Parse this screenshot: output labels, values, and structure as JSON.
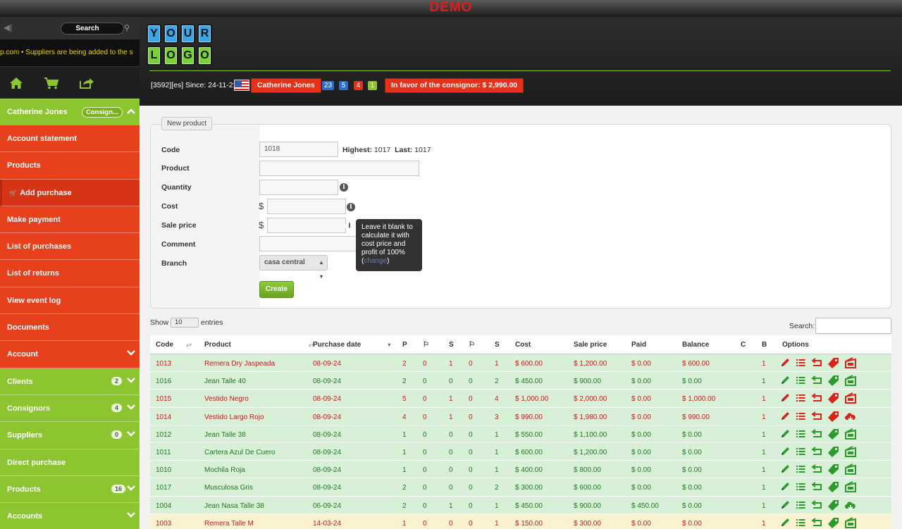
{
  "demo_banner": "DEMO",
  "sidebar": {
    "search_label": "Search",
    "ticker": "p.com  •  Suppliers are being added to the s",
    "user": {
      "name": "Catherine Jones",
      "role_pill": "Consign..."
    },
    "items": [
      {
        "label": "Account statement",
        "color": "red"
      },
      {
        "label": "Products",
        "color": "red"
      },
      {
        "label": "Add purchase",
        "color": "red",
        "active": true
      },
      {
        "label": "Make payment",
        "color": "red"
      },
      {
        "label": "List of purchases",
        "color": "red"
      },
      {
        "label": "List of returns",
        "color": "red"
      },
      {
        "label": "View event log",
        "color": "red"
      },
      {
        "label": "Documents",
        "color": "red"
      },
      {
        "label": "Account",
        "color": "red",
        "chevron": true
      },
      {
        "label": "Clients",
        "color": "green",
        "badge": "2",
        "chevron": true
      },
      {
        "label": "Consignors",
        "color": "green",
        "badge": "4",
        "chevron": true
      },
      {
        "label": "Suppliers",
        "color": "green",
        "badge": "0",
        "chevron": true
      },
      {
        "label": "Direct purchase",
        "color": "green"
      },
      {
        "label": "Products",
        "color": "green",
        "badge": "16",
        "chevron": true
      },
      {
        "label": "Accounts",
        "color": "green",
        "chevron": true
      }
    ]
  },
  "header": {
    "logo_letters": [
      "Y",
      "O",
      "U",
      "R",
      "L",
      "O",
      "G",
      "O"
    ],
    "info": "[3592][es] Since: 24-11-21",
    "user_button": "Catherine Jones",
    "counts": [
      "23",
      "5",
      "4",
      "1"
    ],
    "count_colors": [
      "#2b6fc9",
      "#2b6fc9",
      "#e2321c",
      "#8cc530"
    ],
    "balance_button": "In favor of the consignor: $ 2,990.00"
  },
  "form": {
    "tab": "New product",
    "code_label": "Code",
    "code_value": "1018",
    "highest_label": "Highest:",
    "highest_value": "1017",
    "last_label": "Last:",
    "last_value": "1017",
    "product_label": "Product",
    "quantity_label": "Quantity",
    "cost_label": "Cost",
    "sale_price_label": "Sale price",
    "comment_label": "Comment",
    "branch_label": "Branch",
    "currency": "$",
    "branch_value": "casa central",
    "tooltip_text": "Leave it blank to calculate it with cost price and profit of 100%",
    "tooltip_open": "(",
    "tooltip_link": "change",
    "tooltip_close": ")",
    "create_button": "Create"
  },
  "table": {
    "show_label": "Show",
    "page_size": "10",
    "entries_label": "entries",
    "search_label": "Search:",
    "columns": [
      "Code",
      "Product",
      "Purchase date",
      "P",
      "⚐",
      "S",
      "⚐",
      "S",
      "Cost",
      "Sale price",
      "Paid",
      "Balance",
      "C",
      "B",
      "Options"
    ],
    "rows": [
      {
        "code": "1013",
        "product": "Remera Dry Jaspeada",
        "date": "08-09-24",
        "p": "2",
        "f1": "0",
        "s1": "1",
        "f2": "0",
        "s2": "1",
        "cost": "$ 600.00",
        "sale": "$ 1,200.00",
        "paid": "$ 0.00",
        "balance": "$ 600.00",
        "c": "",
        "b": "1",
        "status": "red",
        "last_icon": "box"
      },
      {
        "code": "1016",
        "product": "Jean Talle 40",
        "date": "08-09-24",
        "p": "2",
        "f1": "0",
        "s1": "0",
        "f2": "0",
        "s2": "2",
        "cost": "$ 450.00",
        "sale": "$ 900.00",
        "paid": "$ 0.00",
        "balance": "$ 0.00",
        "c": "",
        "b": "1",
        "status": "green",
        "last_icon": "box"
      },
      {
        "code": "1015",
        "product": "Vestido Negro",
        "date": "08-09-24",
        "p": "5",
        "f1": "0",
        "s1": "1",
        "f2": "0",
        "s2": "4",
        "cost": "$ 1,000.00",
        "sale": "$ 2,000.00",
        "paid": "$ 0.00",
        "balance": "$ 1,000.00",
        "c": "",
        "b": "1",
        "status": "red",
        "last_icon": "box"
      },
      {
        "code": "1014",
        "product": "Vestido Largo Rojo",
        "date": "08-09-24",
        "p": "4",
        "f1": "0",
        "s1": "1",
        "f2": "0",
        "s2": "3",
        "cost": "$ 990.00",
        "sale": "$ 1,980.00",
        "paid": "$ 0.00",
        "balance": "$ 990.00",
        "c": "",
        "b": "1",
        "status": "red",
        "last_icon": "cloud"
      },
      {
        "code": "1012",
        "product": "Jean Talle 38",
        "date": "08-09-24",
        "p": "1",
        "f1": "0",
        "s1": "0",
        "f2": "0",
        "s2": "1",
        "cost": "$ 550.00",
        "sale": "$ 1,100.00",
        "paid": "$ 0.00",
        "balance": "$ 0.00",
        "c": "",
        "b": "1",
        "status": "green",
        "last_icon": "box"
      },
      {
        "code": "1011",
        "product": "Cartera Azul De Cuero",
        "date": "08-09-24",
        "p": "1",
        "f1": "0",
        "s1": "0",
        "f2": "0",
        "s2": "1",
        "cost": "$ 600.00",
        "sale": "$ 1,200.00",
        "paid": "$ 0.00",
        "balance": "$ 0.00",
        "c": "",
        "b": "1",
        "status": "green",
        "last_icon": "box"
      },
      {
        "code": "1010",
        "product": "Mochila Roja",
        "date": "08-09-24",
        "p": "1",
        "f1": "0",
        "s1": "0",
        "f2": "0",
        "s2": "1",
        "cost": "$ 400.00",
        "sale": "$ 800.00",
        "paid": "$ 0.00",
        "balance": "$ 0.00",
        "c": "",
        "b": "1",
        "status": "green",
        "last_icon": "box"
      },
      {
        "code": "1017",
        "product": "Musculosa Gris",
        "date": "08-09-24",
        "p": "2",
        "f1": "0",
        "s1": "0",
        "f2": "0",
        "s2": "2",
        "cost": "$ 300.00",
        "sale": "$ 600.00",
        "paid": "$ 0.00",
        "balance": "$ 0.00",
        "c": "",
        "b": "1",
        "status": "green",
        "last_icon": "box"
      },
      {
        "code": "1004",
        "product": "Jean Nasa Talle 38",
        "date": "06-09-24",
        "p": "2",
        "f1": "0",
        "s1": "1",
        "f2": "0",
        "s2": "1",
        "cost": "$ 450.00",
        "sale": "$ 900.00",
        "paid": "$ 450.00",
        "balance": "$ 0.00",
        "c": "",
        "b": "1",
        "status": "green",
        "last_icon": "cloud"
      },
      {
        "code": "1003",
        "product": "Remera Talle M",
        "date": "14-03-24",
        "p": "1",
        "f1": "0",
        "s1": "0",
        "f2": "0",
        "s2": "1",
        "cost": "$ 150.00",
        "sale": "$ 300.00",
        "paid": "$ 0.00",
        "balance": "$ 0.00",
        "c": "",
        "b": "1",
        "status": "yellow",
        "last_icon": "box"
      }
    ]
  },
  "colors": {
    "red_nav": "#e7401c",
    "green_nav": "#8cc530",
    "icon_red": "#d8241b",
    "icon_green": "#2c9a2c"
  }
}
